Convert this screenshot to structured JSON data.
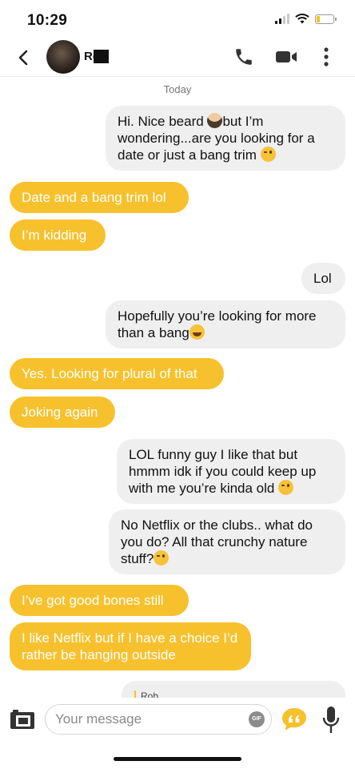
{
  "status_bar": {
    "time": "10:29"
  },
  "header": {
    "contact_name": "Rob"
  },
  "conversation": {
    "day_label": "Today",
    "messages": [
      {
        "from": "me",
        "parts": [
          "Hi. Nice beard ",
          "but I’m wondering...are you looking for a date or just a bang trim "
        ],
        "emoji": [
          "beard",
          "wink"
        ]
      },
      {
        "from": "them",
        "text": "Date and a bang trim lol"
      },
      {
        "from": "them",
        "text": "I’m kidding"
      },
      {
        "from": "me",
        "text": "Lol"
      },
      {
        "from": "me",
        "text": "Hopefully you’re looking for more than a bang",
        "emoji": [
          "laugh"
        ]
      },
      {
        "from": "them",
        "text": "Yes. Looking for plural of that"
      },
      {
        "from": "them",
        "text": "Joking again"
      },
      {
        "from": "me",
        "text": "LOL funny guy I like that but hmmm idk if you could keep up with me you’re kinda old ",
        "emoji": [
          "wink"
        ]
      },
      {
        "from": "me",
        "text": "No Netflix or the clubs.. what do you do? All that crunchy nature stuff?",
        "emoji": [
          "wink"
        ]
      },
      {
        "from": "them",
        "text": "I’ve got good bones still"
      },
      {
        "from": "them",
        "text": "I like Netflix but if I have a choice I’d rather be hanging outside"
      }
    ],
    "reply_preview_name": "Rob"
  },
  "composer": {
    "placeholder": "Your message",
    "gif_label": "GIF"
  },
  "colors": {
    "accent": "#f7c12d",
    "outgoing_bubble": "#efefef"
  }
}
